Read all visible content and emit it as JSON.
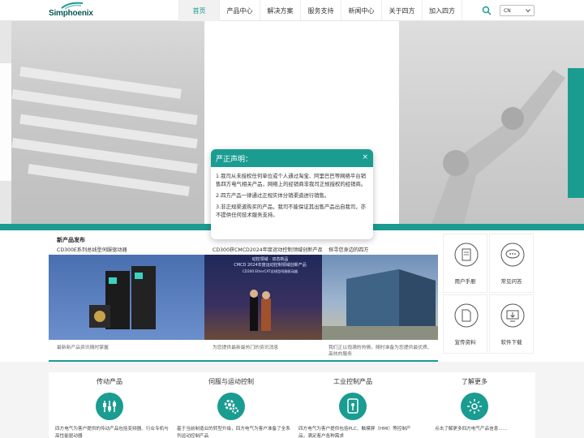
{
  "header": {
    "logo_text": "Simphoenix",
    "nav": [
      "首页",
      "产品中心",
      "解决方案",
      "服务支持",
      "新闻中心",
      "关于四方",
      "加入四方"
    ],
    "lang": "CN",
    "accent": "#1a9c91"
  },
  "modal": {
    "title": "严正声明：",
    "close": "×",
    "paragraphs": [
      "1.我司从未授权任何单位或个人通过淘宝、阿里巴巴等网络平台销售四方电气相关产品，网络上的经销商非我司正规授权的经销商。",
      "2.四方产品一律通过正规实体分销渠道进行销售。",
      "3.非正规渠道购买的产品，我司不能保证其出售产品出自我司，亦不提供任何技术服务支持。"
    ]
  },
  "cards": [
    {
      "title": "新产品发布",
      "sub": "CD300E系列总线型伺服驱动器",
      "desc": "最新新产品资讯随时掌握"
    },
    {
      "title": "",
      "sub": "CD300获CMCD2024年度运动控制领域创新产品",
      "desc": "为您提供最新最热门的资讯消息"
    },
    {
      "title": "",
      "sub": "探寻您身边的四方",
      "desc": "我们正以饱满的热情，随时准备为您提供最优质、高效的服务"
    }
  ],
  "card2_overlay": {
    "line1": "动控领域 · 双态新品",
    "line2": "CMCD 2024年度运动控制领域创新产品",
    "line3": "CD300 EtherCAT总线型伺服驱动器"
  },
  "tiles": [
    {
      "label": "用户手册",
      "icon": "user-manual-icon"
    },
    {
      "label": "常见问答",
      "icon": "faq-icon"
    },
    {
      "label": "宣传资料",
      "icon": "brochure-icon"
    },
    {
      "label": "软件下载",
      "icon": "software-download-icon"
    }
  ],
  "bottom": [
    {
      "title": "传动产品",
      "desc": "四方电气为客户提供的传动产品包括变频器、行业专机与高性能驱动器",
      "icon": "drive-products-icon"
    },
    {
      "title": "伺服与运动控制",
      "desc": "基于当前制造业的转型升级，四方电气为客户准备了全系列运动控制产品",
      "icon": "servo-motion-icon"
    },
    {
      "title": "工业控制产品",
      "desc": "四方电气为客户提供包括PLC、触摸屏（HMI）等控制产品，满足客户各种需求",
      "icon": "industrial-control-icon"
    },
    {
      "title": "了解更多",
      "desc": "点击了解更多四方电气产品信息......",
      "icon": "learn-more-icon"
    }
  ]
}
